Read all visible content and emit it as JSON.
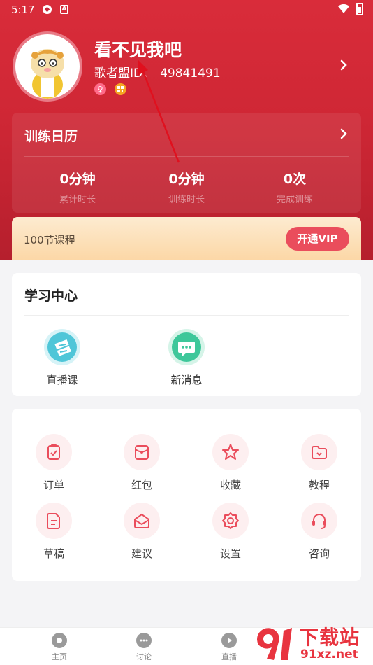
{
  "status_bar": {
    "time": "5:17"
  },
  "profile": {
    "username": "看不见我吧",
    "id_label": "歌者盟ID：",
    "id_value": "49841491",
    "gender_symbol": "♀"
  },
  "calendar": {
    "title": "训练日历",
    "stats": [
      {
        "value": "0分钟",
        "label": "累计时长"
      },
      {
        "value": "0分钟",
        "label": "训练时长"
      },
      {
        "value": "0次",
        "label": "完成训练"
      }
    ]
  },
  "vip": {
    "text": "100节课程",
    "button_label": "开通VIP"
  },
  "study_center": {
    "title": "学习中心",
    "items": [
      {
        "label": "直播课",
        "icon": "ticket-icon",
        "color": "#4fc6d8"
      },
      {
        "label": "新消息",
        "icon": "chat-icon",
        "color": "#3ec79a"
      }
    ]
  },
  "services": [
    {
      "label": "订单",
      "icon": "clipboard-icon"
    },
    {
      "label": "红包",
      "icon": "red-packet-icon"
    },
    {
      "label": "收藏",
      "icon": "star-icon"
    },
    {
      "label": "教程",
      "icon": "folder-icon"
    },
    {
      "label": "草稿",
      "icon": "document-icon"
    },
    {
      "label": "建议",
      "icon": "mail-icon"
    },
    {
      "label": "设置",
      "icon": "gear-icon"
    },
    {
      "label": "咨询",
      "icon": "headset-icon"
    }
  ],
  "tabbar": [
    {
      "label": "主页",
      "icon": "home-icon"
    },
    {
      "label": "讨论",
      "icon": "discussion-icon"
    },
    {
      "label": "直播",
      "icon": "play-icon"
    }
  ],
  "watermark": {
    "title": "下载站",
    "url": "91xz.net"
  },
  "colors": {
    "header_red": "#d92c3a",
    "accent": "#ea4d5c",
    "vip_gold": "#fcd7a6"
  }
}
